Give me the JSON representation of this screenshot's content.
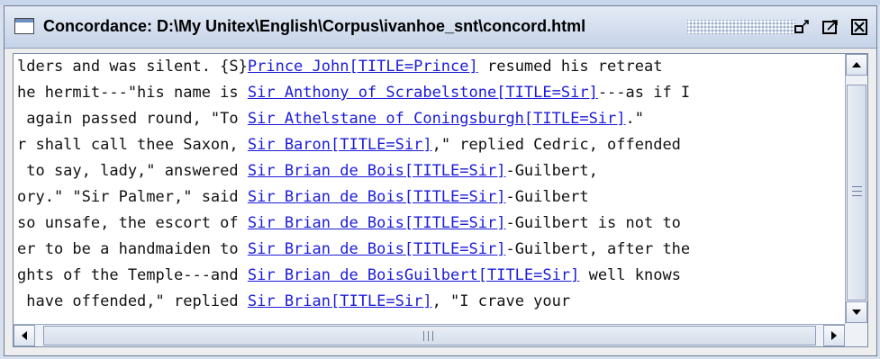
{
  "window": {
    "title": "Concordance: D:\\My Unitex\\English\\Corpus\\ivanhoe_snt\\concord.html",
    "buttons": [
      "minimize-icon",
      "maximize-icon",
      "close-icon"
    ]
  },
  "concordance": {
    "lines": [
      {
        "left": "lders and was silent. {S}",
        "match": "Prince John[TITLE=Prince]",
        "right": " resumed his retreat"
      },
      {
        "left": "he hermit---\"his name is ",
        "match": "Sir Anthony of Scrabelstone[TITLE=Sir]",
        "right": "---as if I"
      },
      {
        "left": " again passed round, \"To ",
        "match": "Sir Athelstane of Coningsburgh[TITLE=Sir]",
        "right": ".\""
      },
      {
        "left": "r shall call thee Saxon, ",
        "match": "Sir Baron[TITLE=Sir]",
        "right": ",\" replied Cedric, offended"
      },
      {
        "left": " to say, lady,\" answered ",
        "match": "Sir Brian de Bois[TITLE=Sir]",
        "right": "-Guilbert,"
      },
      {
        "left": "ory.\" \"Sir Palmer,\" said ",
        "match": "Sir Brian de Bois[TITLE=Sir]",
        "right": "-Guilbert"
      },
      {
        "left": "so unsafe, the escort of ",
        "match": "Sir Brian de Bois[TITLE=Sir]",
        "right": "-Guilbert is not to"
      },
      {
        "left": "er to be a handmaiden to ",
        "match": "Sir Brian de Bois[TITLE=Sir]",
        "right": "-Guilbert, after the"
      },
      {
        "left": "ghts of the Temple---and ",
        "match": "Sir Brian de BoisGuilbert[TITLE=Sir]",
        "right": " well knows"
      },
      {
        "left": " have offended,\" replied ",
        "match": "Sir Brian[TITLE=Sir]",
        "right": ", \"I crave your"
      }
    ]
  },
  "colors": {
    "match_link": "#1b1bd9",
    "titlebar": "#c6d3e8"
  }
}
